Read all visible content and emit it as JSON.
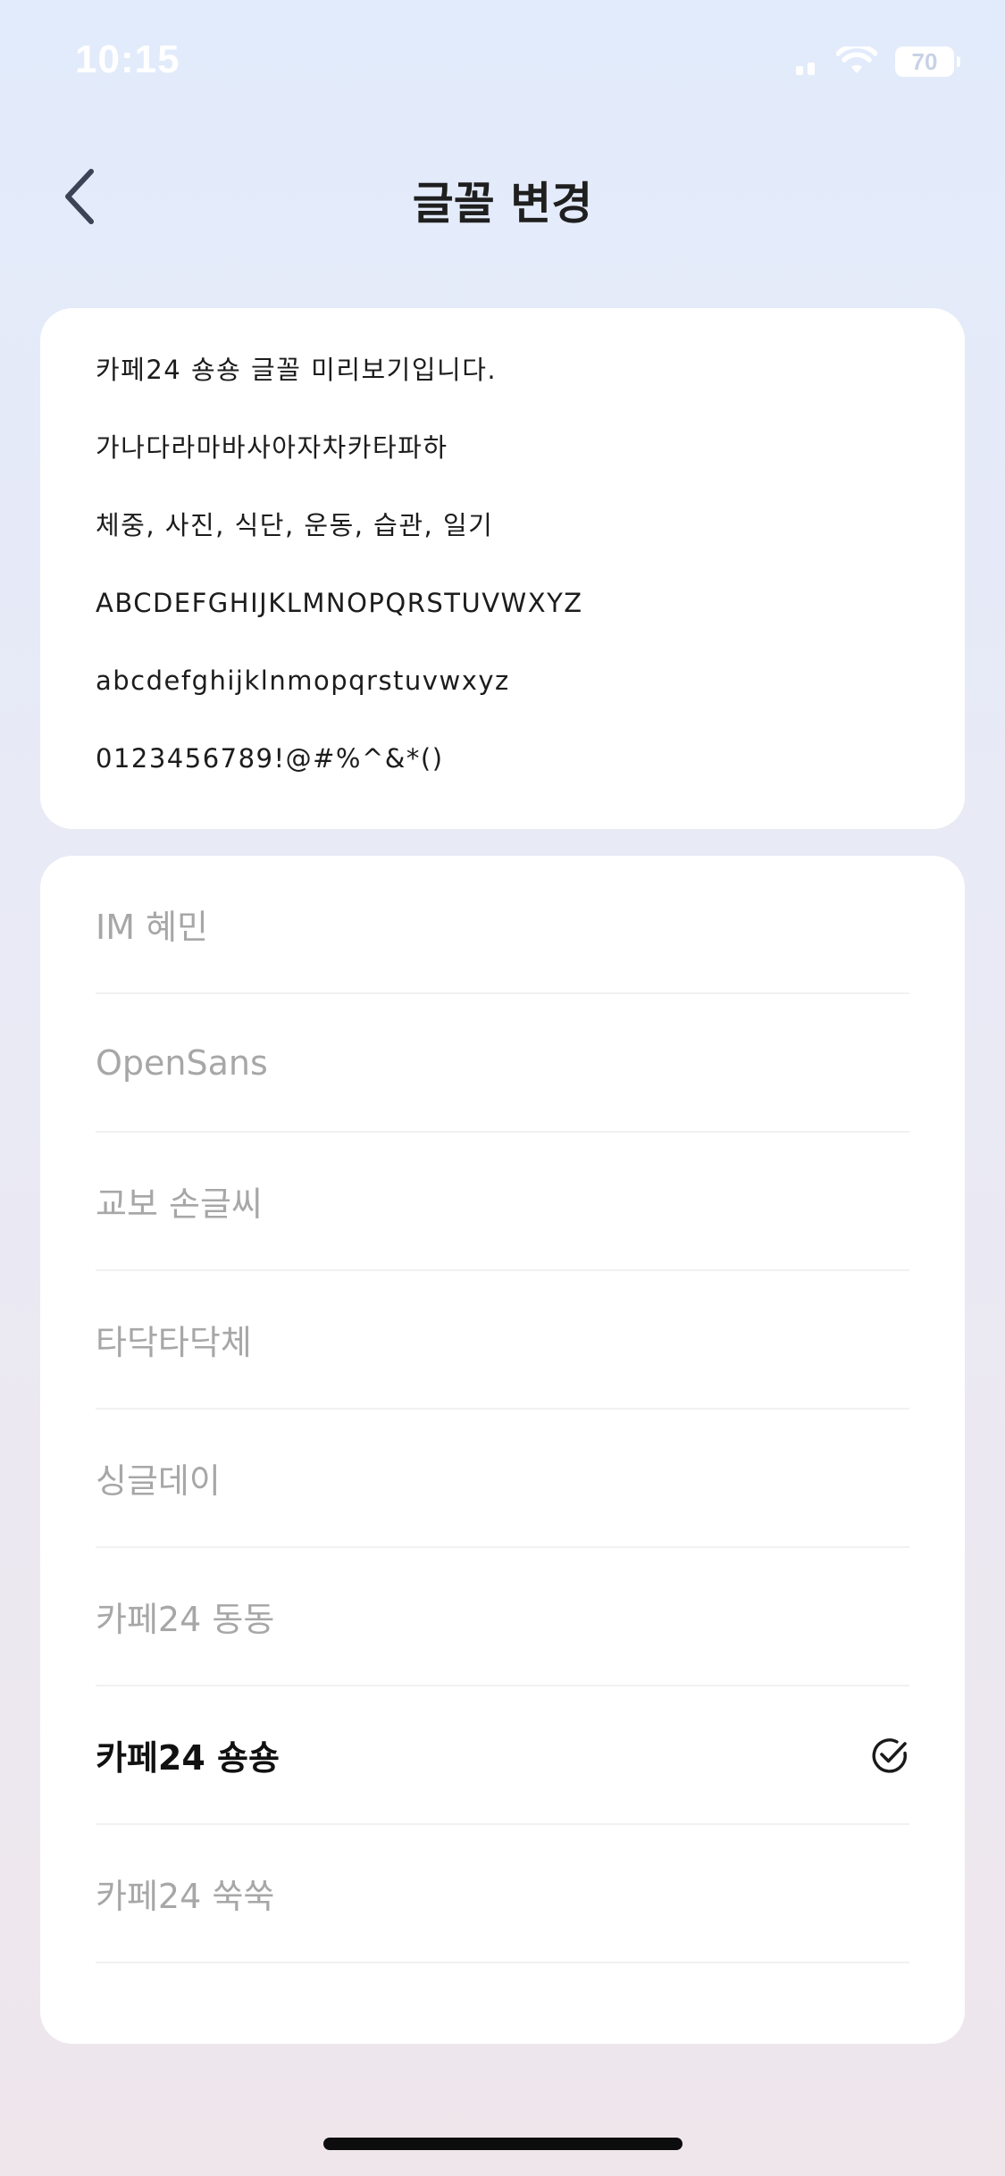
{
  "status_bar": {
    "time": "10:15",
    "battery": "70"
  },
  "header": {
    "title": "글꼴 변경"
  },
  "preview": {
    "lines": [
      "카페24 숑숑 글꼴 미리보기입니다.",
      "가나다라마바사아자차카타파하",
      "체중, 사진, 식단, 운동, 습관, 일기",
      "ABCDEFGHIJKLMNOPQRSTUVWXYZ",
      "abcdefghijklnmopqrstuvwxyz",
      "0123456789!@#%^&*()"
    ]
  },
  "font_list": {
    "items": [
      {
        "label": "IM 혜민",
        "selected": false
      },
      {
        "label": "OpenSans",
        "selected": false
      },
      {
        "label": "교보 손글씨",
        "selected": false
      },
      {
        "label": "타닥타닥체",
        "selected": false
      },
      {
        "label": "싱글데이",
        "selected": false
      },
      {
        "label": "카페24 동동",
        "selected": false
      },
      {
        "label": "카페24 숑숑",
        "selected": true
      },
      {
        "label": "카페24 쑥쑥",
        "selected": false
      }
    ]
  },
  "icons": {
    "back": "chevron-left-icon",
    "selected": "check-circle-icon",
    "wifi": "wifi-icon",
    "signal": "signal-icon",
    "battery": "battery-icon"
  },
  "colors": {
    "title": "#1f1f1f",
    "unselected_text": "#a7a7a7",
    "selected_text": "#111111",
    "card": "#ffffff"
  }
}
